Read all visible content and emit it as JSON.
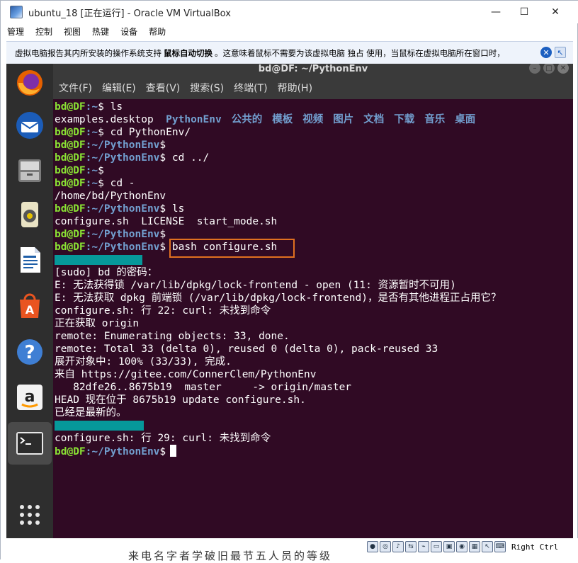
{
  "window": {
    "title": "ubuntu_18 [正在运行] - Oracle VM VirtualBox",
    "controls": {
      "minimize": "—",
      "maximize": "☐",
      "close": "✕"
    }
  },
  "host_menu": [
    "管理",
    "控制",
    "视图",
    "热键",
    "设备",
    "帮助"
  ],
  "notification": {
    "before": "虚拟电脑报告其内所安装的操作系统支持",
    "bold": "鼠标自动切换",
    "after": "。这意味着鼠标不需要为该虚拟电脑 独占 使用，当鼠标在虚拟电脑所在窗口时，"
  },
  "terminal": {
    "title": "bd@DF: ~/PythonEnv",
    "menu": [
      "文件(F)",
      "编辑(E)",
      "查看(V)",
      "搜索(S)",
      "终端(T)",
      "帮助(H)"
    ],
    "prompt_user": "bd@DF",
    "lines": {
      "l1_path": ":~",
      "l1_cmd": "$ ls",
      "l2_file": "examples.desktop",
      "l2_dirs": [
        "PythonEnv",
        "公共的",
        "模板",
        "视频",
        "图片",
        "文档",
        "下载",
        "音乐",
        "桌面"
      ],
      "l3_path": ":~",
      "l3_cmd": "$ cd PythonEnv/",
      "l4_path": ":~/PythonEnv",
      "l4_cmd": "$",
      "l5_path": ":~/PythonEnv",
      "l5_cmd": "$ cd ../",
      "l6_path": ":~",
      "l6_cmd": "$",
      "l7_path": ":~",
      "l7_cmd": "$ cd -",
      "l8": "/home/bd/PythonEnv",
      "l9_path": ":~/PythonEnv",
      "l9_cmd": "$ ls",
      "l10": "configure.sh  LICENSE  start_mode.sh",
      "l11_path": ":~/PythonEnv",
      "l11_cmd": "$",
      "l12_path": ":~/PythonEnv",
      "l12_cmd": "$ bash configure.sh",
      "l14": "[sudo] bd 的密码：",
      "l15": "E: 无法获得锁 /var/lib/dpkg/lock-frontend - open (11: 资源暂时不可用)",
      "l16": "E: 无法获取 dpkg 前端锁 (/var/lib/dpkg/lock-frontend)，是否有其他进程正占用它？",
      "l17": "configure.sh: 行 22: curl: 未找到命令",
      "l18": "正在获取 origin",
      "l19": "remote: Enumerating objects: 33, done.",
      "l20": "remote: Total 33 (delta 0), reused 0 (delta 0), pack-reused 33",
      "l21": "展开对象中: 100% (33/33), 完成.",
      "l22": "来自 https://gitee.com/ConnerClem/PythonEnv",
      "l23": "   82dfe26..8675b19  master     -> origin/master",
      "l24": "HEAD 现在位于 8675b19 update configure.sh.",
      "l25": "已经是最新的。",
      "l27": "configure.sh: 行 29: curl: 未找到命令",
      "l28_path": ":~/PythonEnv",
      "l28_cmd": "$"
    }
  },
  "dock": {
    "items": [
      "firefox-icon",
      "thunderbird-icon",
      "files-icon",
      "rhythmbox-icon",
      "writer-icon",
      "software-icon",
      "help-icon",
      "amazon-icon",
      "terminal-icon",
      "apps-grid-icon"
    ],
    "accent": "#e95420"
  },
  "statusbar": {
    "background_text": "来电名字者学破旧最节五人员的等级",
    "host_key": "Right Ctrl"
  },
  "colors": {
    "terminal_bg": "#300a24",
    "prompt_green": "#8ae234",
    "path_blue": "#729fcf",
    "highlight_orange": "#e07020",
    "teal": "#06989a"
  }
}
